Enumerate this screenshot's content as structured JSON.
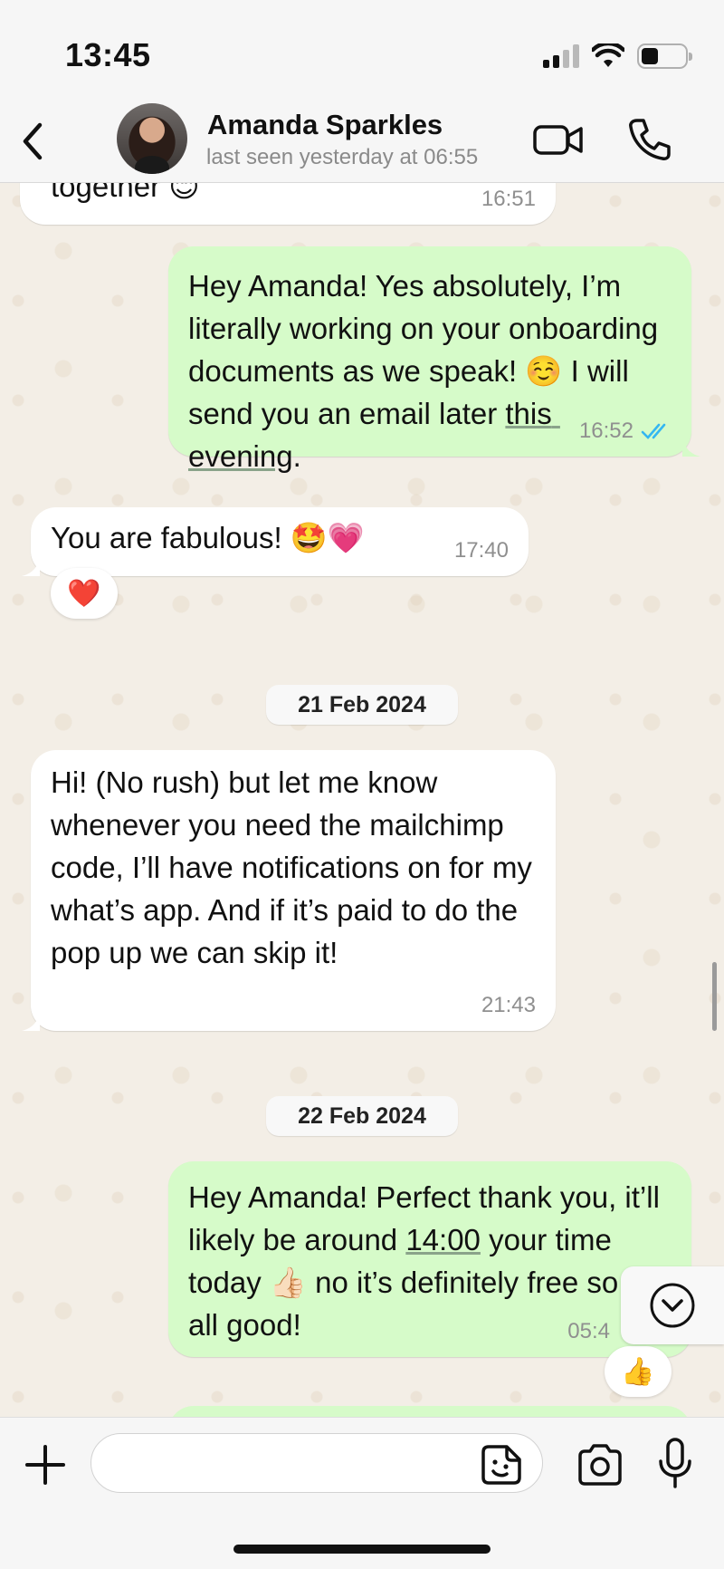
{
  "status_bar": {
    "time": "13:45"
  },
  "header": {
    "contact_name": "Amanda Sparkles",
    "last_seen": "last seen yesterday at 06:55"
  },
  "messages": [
    {
      "direction": "in",
      "text": "together 😊",
      "time": "16:51"
    },
    {
      "direction": "out",
      "text_before_link": "Hey Amanda! Yes absolutely, I’m literally working on your onboarding documents as we speak! ☺️ I will send you an email later ",
      "link": "this evening",
      "text_after_link": ".",
      "time": "16:52",
      "read": true
    },
    {
      "direction": "in",
      "text": "You are fabulous! 🤩💗",
      "time": "17:40",
      "reaction": "❤️"
    },
    {
      "direction": "in",
      "text": "Hi! (No rush) but let me know whenever you need the mailchimp code, I’ll have notifications on for my what’s app. And if it’s paid to do the pop up we can skip it!",
      "time": "21:43"
    },
    {
      "direction": "out",
      "text_before_link": "Hey Amanda! Perfect thank you, it’ll likely be around ",
      "link": "14:00",
      "text_after_link": " your time today 👍🏻 no it’s definitely free so it’s all good!",
      "time": "05:4",
      "reaction": "👍"
    }
  ],
  "date_separators": [
    "21 Feb 2024",
    "22 Feb 2024"
  ],
  "composer": {
    "placeholder": ""
  },
  "colors": {
    "incoming_bubble": "#ffffff",
    "outgoing_bubble": "#d6fbc9",
    "read_ticks": "#34b7f1",
    "chat_background": "#f3eee6"
  },
  "icons": [
    "back-chevron-icon",
    "video-camera-icon",
    "phone-icon",
    "plus-icon",
    "sticker-icon",
    "camera-icon",
    "microphone-icon",
    "chevron-down-icon",
    "double-check-icon"
  ]
}
